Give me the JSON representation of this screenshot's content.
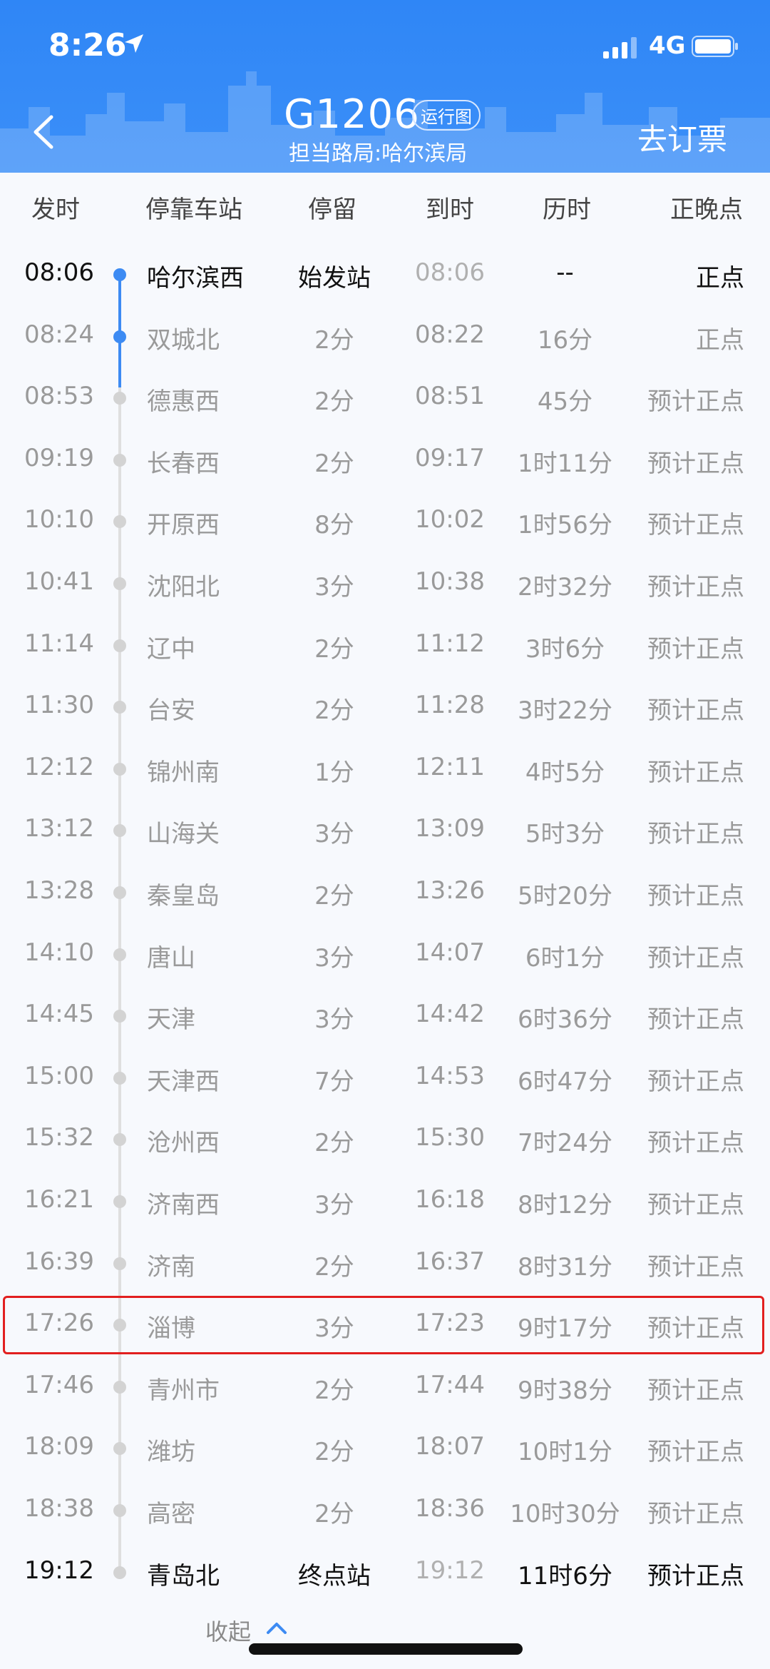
{
  "status_bar": {
    "time": "8:26",
    "network": "4G"
  },
  "header": {
    "train_no": "G1206",
    "map_tag": "运行图",
    "bureau": "担当路局:哈尔滨局",
    "book_label": "去订票"
  },
  "columns": {
    "dep": "发时",
    "station": "停靠车站",
    "stay": "停留",
    "arr": "到时",
    "duration": "历时",
    "status": "正晚点"
  },
  "stops": [
    {
      "dep": "08:06",
      "station": "哈尔滨西",
      "stay": "始发站",
      "arr": "08:06",
      "duration": "--",
      "status": "正点",
      "bold": true,
      "passed": true
    },
    {
      "dep": "08:24",
      "station": "双城北",
      "stay": "2分",
      "arr": "08:22",
      "duration": "16分",
      "status": "正点",
      "passed": true
    },
    {
      "dep": "08:53",
      "station": "德惠西",
      "stay": "2分",
      "arr": "08:51",
      "duration": "45分",
      "status": "预计正点"
    },
    {
      "dep": "09:19",
      "station": "长春西",
      "stay": "2分",
      "arr": "09:17",
      "duration": "1时11分",
      "status": "预计正点"
    },
    {
      "dep": "10:10",
      "station": "开原西",
      "stay": "8分",
      "arr": "10:02",
      "duration": "1时56分",
      "status": "预计正点"
    },
    {
      "dep": "10:41",
      "station": "沈阳北",
      "stay": "3分",
      "arr": "10:38",
      "duration": "2时32分",
      "status": "预计正点"
    },
    {
      "dep": "11:14",
      "station": "辽中",
      "stay": "2分",
      "arr": "11:12",
      "duration": "3时6分",
      "status": "预计正点"
    },
    {
      "dep": "11:30",
      "station": "台安",
      "stay": "2分",
      "arr": "11:28",
      "duration": "3时22分",
      "status": "预计正点"
    },
    {
      "dep": "12:12",
      "station": "锦州南",
      "stay": "1分",
      "arr": "12:11",
      "duration": "4时5分",
      "status": "预计正点"
    },
    {
      "dep": "13:12",
      "station": "山海关",
      "stay": "3分",
      "arr": "13:09",
      "duration": "5时3分",
      "status": "预计正点"
    },
    {
      "dep": "13:28",
      "station": "秦皇岛",
      "stay": "2分",
      "arr": "13:26",
      "duration": "5时20分",
      "status": "预计正点"
    },
    {
      "dep": "14:10",
      "station": "唐山",
      "stay": "3分",
      "arr": "14:07",
      "duration": "6时1分",
      "status": "预计正点"
    },
    {
      "dep": "14:45",
      "station": "天津",
      "stay": "3分",
      "arr": "14:42",
      "duration": "6时36分",
      "status": "预计正点"
    },
    {
      "dep": "15:00",
      "station": "天津西",
      "stay": "7分",
      "arr": "14:53",
      "duration": "6时47分",
      "status": "预计正点"
    },
    {
      "dep": "15:32",
      "station": "沧州西",
      "stay": "2分",
      "arr": "15:30",
      "duration": "7时24分",
      "status": "预计正点"
    },
    {
      "dep": "16:21",
      "station": "济南西",
      "stay": "3分",
      "arr": "16:18",
      "duration": "8时12分",
      "status": "预计正点"
    },
    {
      "dep": "16:39",
      "station": "济南",
      "stay": "2分",
      "arr": "16:37",
      "duration": "8时31分",
      "status": "预计正点"
    },
    {
      "dep": "17:26",
      "station": "淄博",
      "stay": "3分",
      "arr": "17:23",
      "duration": "9时17分",
      "status": "预计正点",
      "highlight": true
    },
    {
      "dep": "17:46",
      "station": "青州市",
      "stay": "2分",
      "arr": "17:44",
      "duration": "9时38分",
      "status": "预计正点"
    },
    {
      "dep": "18:09",
      "station": "潍坊",
      "stay": "2分",
      "arr": "18:07",
      "duration": "10时1分",
      "status": "预计正点"
    },
    {
      "dep": "18:38",
      "station": "高密",
      "stay": "2分",
      "arr": "18:36",
      "duration": "10时30分",
      "status": "预计正点"
    },
    {
      "dep": "19:12",
      "station": "青岛北",
      "stay": "终点站",
      "arr": "19:12",
      "duration": "11时6分",
      "status": "预计正点",
      "bold": true
    }
  ],
  "footer": {
    "collapse_label": "收起"
  },
  "colors": {
    "accent": "#3d8bf3",
    "highlight_border": "#e21f1f",
    "header_bg": "#2f86f6"
  }
}
